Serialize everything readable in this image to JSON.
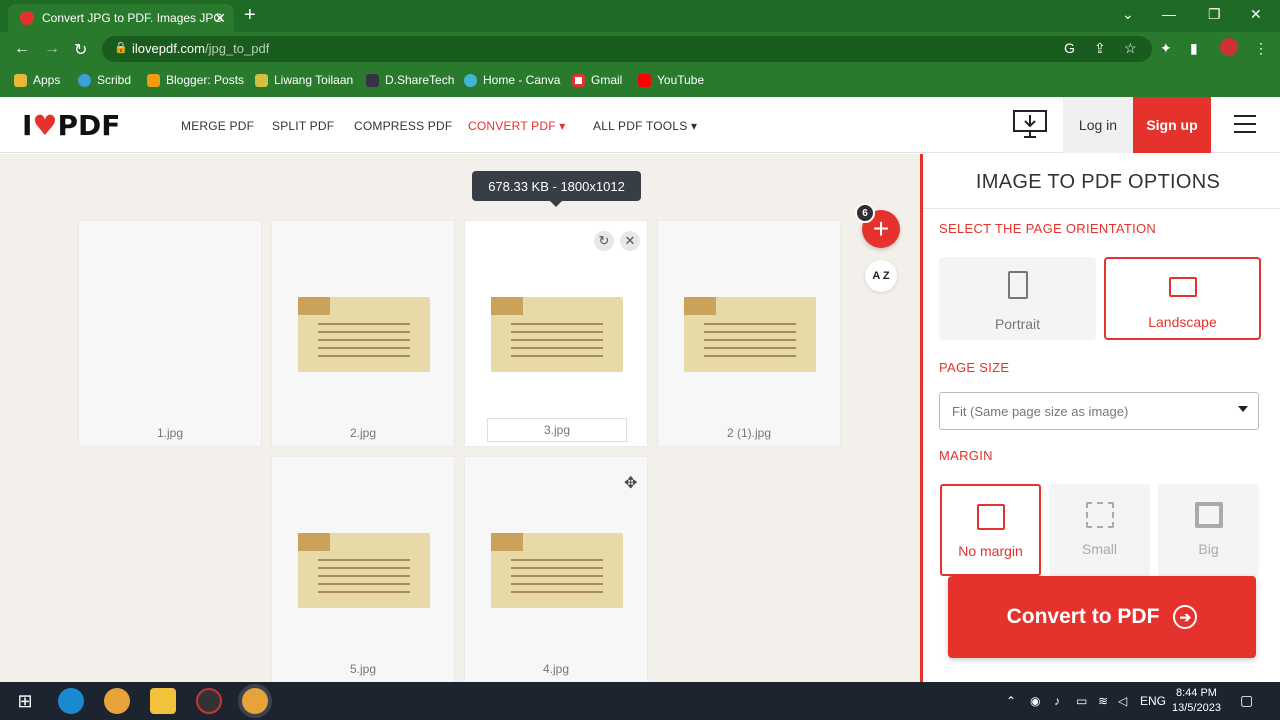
{
  "browser": {
    "tab_title": "Convert JPG to PDF. Images JPG",
    "url_host": "ilovepdf.com",
    "url_path": "/jpg_to_pdf",
    "bookmarks": [
      "Apps",
      "Scribd",
      "Blogger: Posts",
      "Liwang Toilaan",
      "D.ShareTech",
      "Home - Canva",
      "Gmail",
      "YouTube"
    ]
  },
  "nav": {
    "logo_left": "I",
    "logo_right": "PDF",
    "links": [
      "MERGE PDF",
      "SPLIT PDF",
      "COMPRESS PDF",
      "CONVERT PDF ▾",
      "ALL PDF TOOLS ▾"
    ],
    "login": "Log in",
    "signup": "Sign up"
  },
  "workspace": {
    "tooltip": "678.33 KB - 1800x1012",
    "file_count": "6",
    "sort_label": "A Z",
    "files": [
      "1.jpg",
      "2.jpg",
      "3.jpg",
      "2 (1).jpg",
      "5.jpg",
      "4.jpg"
    ]
  },
  "options": {
    "title": "IMAGE TO PDF OPTIONS",
    "orientation_label": "SELECT THE PAGE ORIENTATION",
    "portrait": "Portrait",
    "landscape": "Landscape",
    "page_size_label": "PAGE SIZE",
    "page_size_value": "Fit (Same page size as image)",
    "margin_label": "MARGIN",
    "margin_none": "No margin",
    "margin_small": "Small",
    "margin_big": "Big",
    "convert": "Convert to PDF"
  },
  "taskbar": {
    "lang": "ENG",
    "time": "8:44 PM",
    "date": "13/5/2023"
  },
  "colors": {
    "brand_red": "#e5322d",
    "chrome_green": "#2a7a2d"
  }
}
